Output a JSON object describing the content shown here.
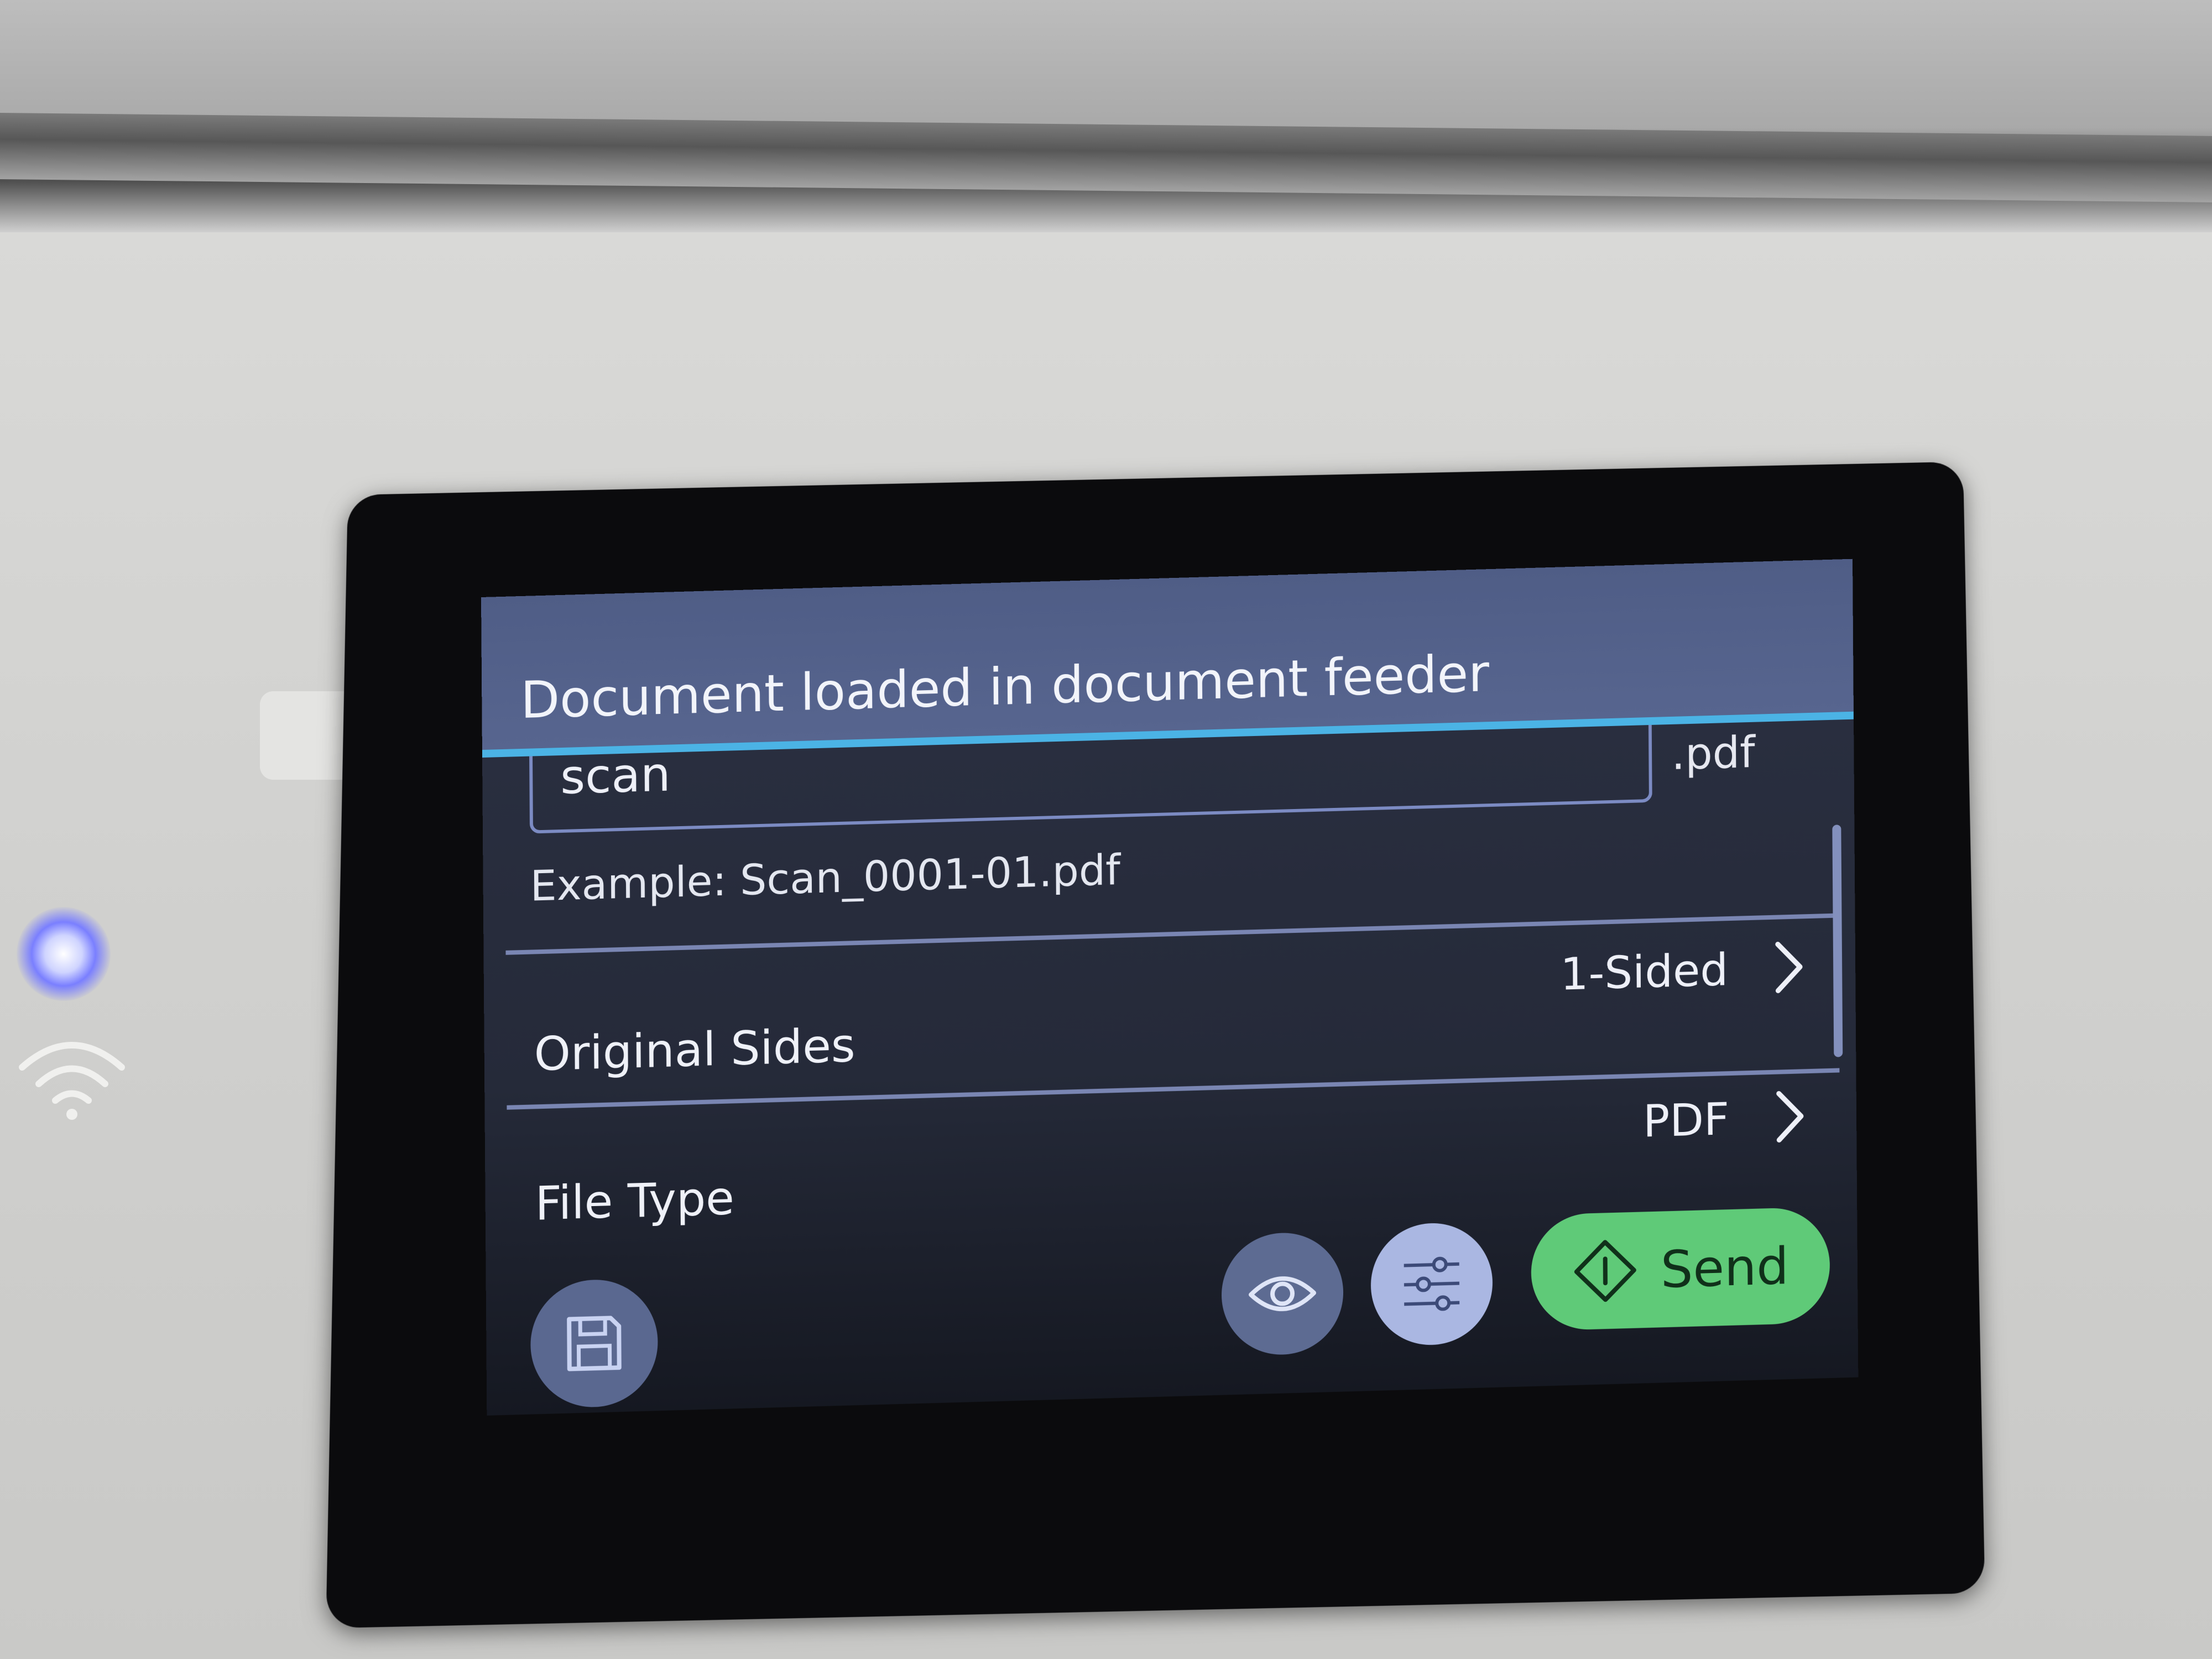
{
  "notification": {
    "message": "Document loaded in document feeder"
  },
  "file_name": {
    "value": "scan",
    "extension": ".pdf",
    "example": "Example: Scan_0001-01.pdf"
  },
  "settings": [
    {
      "label": "Original Sides",
      "value": "1-Sided"
    },
    {
      "label": "File Type",
      "value": "PDF"
    }
  ],
  "toolbar": {
    "save_icon": "save-icon",
    "preview_icon": "eye-icon",
    "settings_icon": "sliders-icon",
    "send_label": "Send",
    "send_icon": "start-diamond-icon"
  },
  "colors": {
    "notice_bar": "#57658f",
    "accent_line": "#4bb3e5",
    "send_button": "#5fca78",
    "screen_background": "#252a39",
    "status_led": "#7a7fff"
  },
  "device": {
    "status_light": "on",
    "wireless_icon": "wifi-icon"
  }
}
